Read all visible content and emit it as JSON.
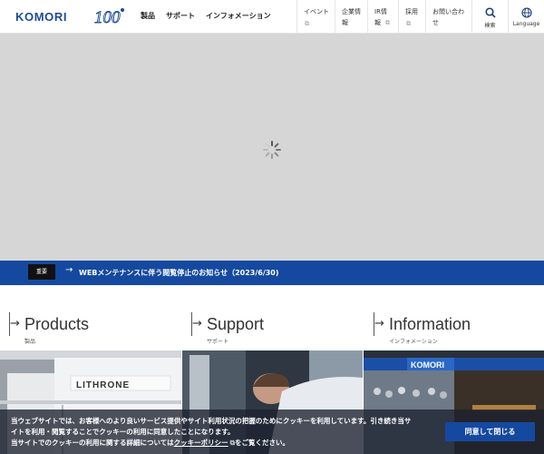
{
  "header": {
    "logo": "KOMORI",
    "anniversary": "100",
    "nav": [
      "製品",
      "サポート",
      "インフォメーション"
    ],
    "subnav": [
      {
        "line1": "イベント",
        "line2": "",
        "external": true
      },
      {
        "line1": "企業情",
        "line2": "報",
        "external": false
      },
      {
        "line1": "IR情",
        "line2": "報",
        "external": true
      },
      {
        "line1": "採用",
        "line2": "",
        "external": true
      },
      {
        "line1": "お問い合わ",
        "line2": "せ",
        "external": false
      }
    ],
    "search_label": "検索",
    "language_label": "Language",
    "search_icon": "search-icon",
    "language_icon": "globe-icon"
  },
  "notice": {
    "badge": "重要",
    "text": "WEBメンテナンスに伴う閲覧停止のお知らせ（2023/6/30)"
  },
  "categories": [
    {
      "title": "Products",
      "sub": "製品"
    },
    {
      "title": "Support",
      "sub": "サポート"
    },
    {
      "title": "Information",
      "sub": "インフォメーション"
    }
  ],
  "photos": {
    "p1_sign": "LITHRONE",
    "p3_sign": "KOMORI"
  },
  "cookie": {
    "line1": "当ウェブサイトでは、お客様へのより良いサービス提供やサイト利用状況の把握のためにクッキーを利用しています。引き続き当サ",
    "line2": "イトを利用・閲覧することでクッキーの利用に同意したことになります。",
    "line3_pre": "当サイトでのクッキーの利用に関する詳細については",
    "policy_link": "クッキーポリシー",
    "line3_post": "をご覧ください。",
    "agree_button": "同意して閉じる"
  },
  "colors": {
    "brand_blue": "#1549a0",
    "hero_gray": "#d6d6d6"
  }
}
